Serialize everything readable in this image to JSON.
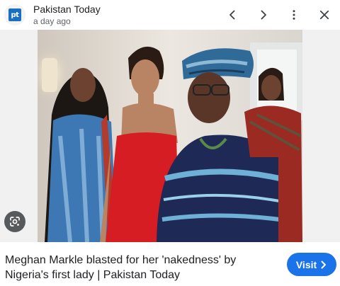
{
  "header": {
    "source_logo_text": "pt",
    "source_name": "Pakistan Today",
    "timestamp": "a day ago"
  },
  "toolbar": {
    "prev_icon": "chevron-left-icon",
    "next_icon": "chevron-right-icon",
    "more_icon": "more-vert-icon",
    "close_icon": "close-icon"
  },
  "image": {
    "lens_icon": "google-lens-icon"
  },
  "result": {
    "caption": "Meghan Markle blasted for her 'nakedness' by Nigeria's first lady | Pakistan Today",
    "visit_label": "Visit",
    "visit_icon": "chevron-right-icon"
  },
  "colors": {
    "accent": "#1a73e8",
    "logo_bg": "#1b6fc2",
    "text": "#202124",
    "muted": "#5f6368"
  }
}
